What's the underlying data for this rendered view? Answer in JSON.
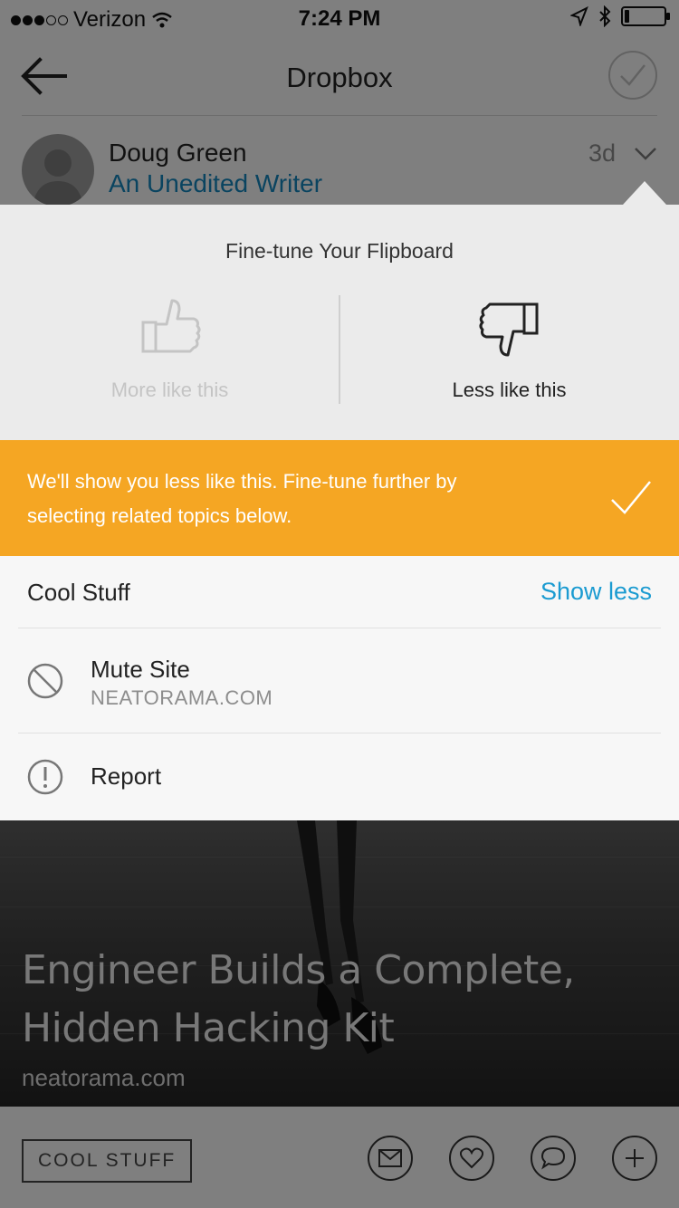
{
  "status_bar": {
    "carrier": "Verizon",
    "time": "7:24 PM",
    "signal_bars_filled": 3,
    "signal_bars_total": 5,
    "battery_level": 0.12
  },
  "nav": {
    "title": "Dropbox"
  },
  "author": {
    "name": "Doug Green",
    "subtitle": "An Unedited Writer",
    "age": "3d"
  },
  "popover": {
    "heading": "Fine-tune Your Flipboard",
    "more_label": "More like this",
    "less_label": "Less like this",
    "selected": "less",
    "notice": "We'll show you less like this. Fine-tune further by selecting related topics below.",
    "topic": {
      "name": "Cool Stuff",
      "action": "Show less"
    },
    "mute": {
      "title": "Mute Site",
      "site": "NEATORAMA.COM"
    },
    "report": {
      "title": "Report"
    }
  },
  "article": {
    "headline": "Engineer Builds a Complete, Hidden Hacking Kit",
    "domain": "neatorama.com"
  },
  "footer": {
    "tag": "COOL STUFF"
  },
  "colors": {
    "accent_orange": "#f5a623",
    "link_blue": "#1b9bd1",
    "author_blue": "#1582b8"
  },
  "icons": {
    "back": "arrow-left-icon",
    "done": "checkmark-circle-icon",
    "more": "thumbs-up-icon",
    "less": "thumbs-down-icon",
    "mute": "no-entry-icon",
    "report": "exclamation-circle-icon",
    "share": "envelope-icon",
    "like": "heart-icon",
    "comment": "speech-bubble-icon",
    "flip": "plus-icon"
  }
}
